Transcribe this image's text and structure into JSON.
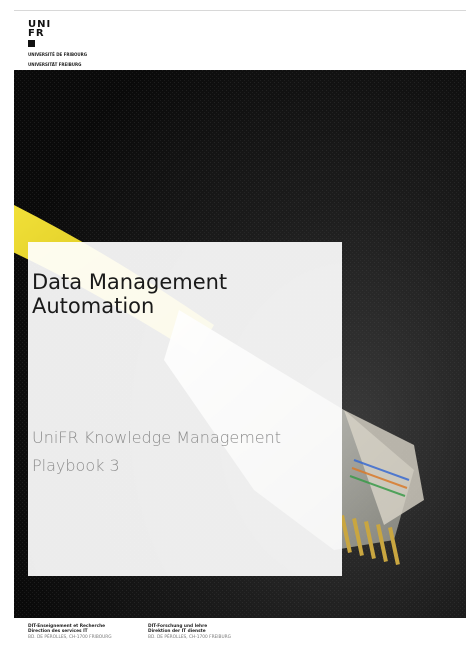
{
  "logo": {
    "line1": "UNI",
    "line2": "FR",
    "sub1": "UNIVERSITÉ DE FRIBOURG",
    "sub2": "UNIVERSITÄT FREIBURG"
  },
  "document": {
    "title_line1": "Data Management",
    "title_line2": "Automation",
    "subtitle_line1": "UniFR Knowledge Management",
    "subtitle_line2": "Playbook 3"
  },
  "footer": {
    "fr": {
      "line1": "DIT-Enseignement et Recherche",
      "line2": "Direction des services IT",
      "line3": "BD. DE PÉROLLES, CH-1700 FRIBOURG"
    },
    "de": {
      "line1": "DIT-Forschung und lehre",
      "line2": "Direktion der IT dienste",
      "line3": "BD. DE PÉROLLES, CH-1700 FREIBURG"
    }
  },
  "colors": {
    "photo_dark": "#111111",
    "cable_yellow": "#e6d21a",
    "title_text": "#1a1a1a",
    "subtitle_text": "#8c8c8c"
  }
}
